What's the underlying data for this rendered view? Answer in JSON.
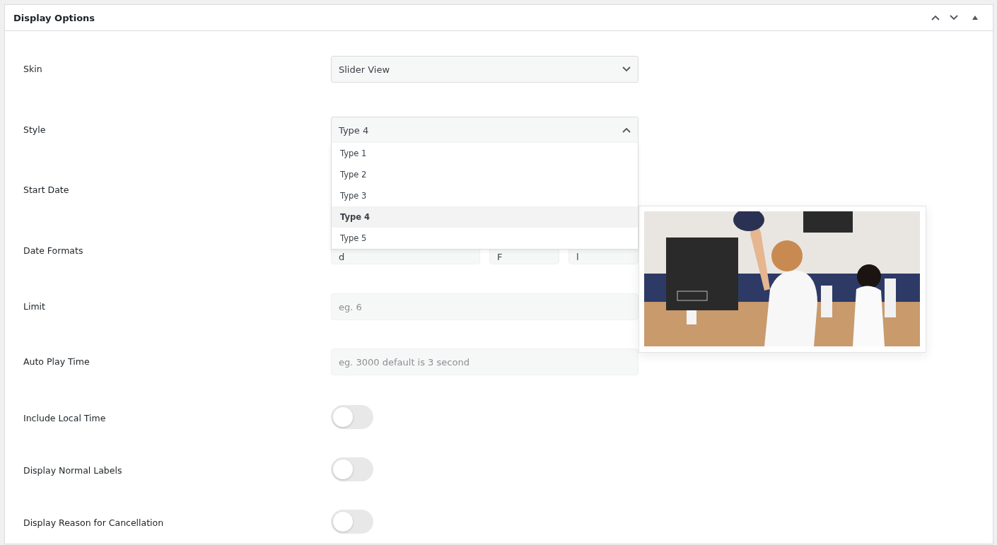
{
  "panel": {
    "title": "Display Options"
  },
  "rows": [
    {
      "kind": "select",
      "label": "Skin",
      "value": "Slider View",
      "expanded": false
    },
    {
      "kind": "select",
      "label": "Style",
      "value": "Type 4",
      "expanded": true,
      "options": [
        {
          "label": "Type 1",
          "selected": false
        },
        {
          "label": "Type 2",
          "selected": false
        },
        {
          "label": "Type 3",
          "selected": false
        },
        {
          "label": "Type 4",
          "selected": true
        },
        {
          "label": "Type 5",
          "selected": false
        }
      ]
    },
    {
      "kind": "hidden",
      "label": "Start Date"
    },
    {
      "kind": "formats",
      "label": "Date Formats",
      "values": [
        "d",
        "F",
        "l"
      ]
    },
    {
      "kind": "text",
      "label": "Limit",
      "placeholder": "eg. 6"
    },
    {
      "kind": "text",
      "label": "Auto Play Time",
      "placeholder": "eg. 3000 default is 3 second"
    },
    {
      "kind": "toggle",
      "label": "Include Local Time",
      "on": false
    },
    {
      "kind": "toggle",
      "label": "Display Normal Labels",
      "on": false
    },
    {
      "kind": "toggle",
      "label": "Display Reason for Cancellation",
      "on": false
    }
  ]
}
